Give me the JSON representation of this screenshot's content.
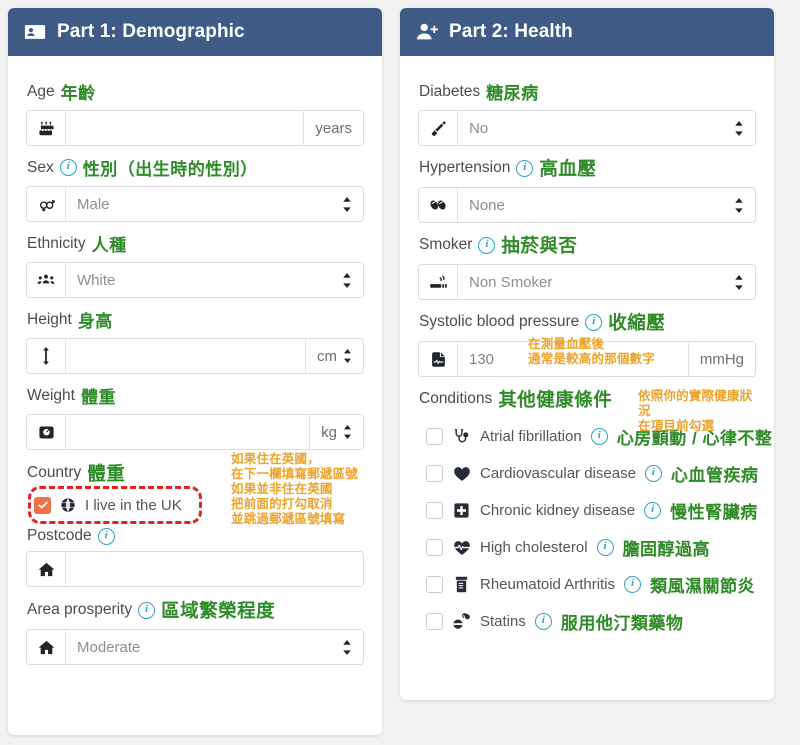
{
  "colors": {
    "header_bg": "#3f5c87",
    "translation_green": "#2e8b28",
    "annotation_orange": "#eda22a",
    "highlight_red": "#e0231f",
    "checkbox_orange": "#ef7147",
    "info_blue": "#29a3c4"
  },
  "part1": {
    "title": "Part 1: Demographic",
    "header_icon": "id-card-icon",
    "fields": {
      "age": {
        "label": "Age",
        "zh": "年齡",
        "icon": "birthday-cake-icon",
        "value": "",
        "unit": "years"
      },
      "sex": {
        "label": "Sex",
        "zh": "性別（出生時的性別）",
        "icon": "gender-icon",
        "value": "Male"
      },
      "ethnicity": {
        "label": "Ethnicity",
        "zh": "人種",
        "icon": "people-group-icon",
        "value": "White"
      },
      "height": {
        "label": "Height",
        "zh": "身高",
        "icon": "arrows-up-down-icon",
        "value": "",
        "unit": "cm"
      },
      "weight": {
        "label": "Weight",
        "zh": "體重",
        "icon": "weight-scale-icon",
        "value": "",
        "unit": "kg"
      },
      "country": {
        "label": "Country",
        "zh": "體重",
        "checkbox_icon": "globe-icon",
        "checkbox_label": "I live in the UK",
        "checked": true,
        "note": "如果住在英國，\n在下一欄填寫郵遞區號\n如果並非住在英國\n把前面的打勾取消\n並跳過郵遞區號填寫"
      },
      "postcode": {
        "label": "Postcode",
        "icon": "home-icon",
        "value": ""
      },
      "area_prosperity": {
        "label": "Area prosperity",
        "zh": "區域繁榮程度",
        "icon": "home-icon",
        "value": "Moderate"
      }
    }
  },
  "part2": {
    "title": "Part 2: Health",
    "header_icon": "user-plus-icon",
    "fields": {
      "diabetes": {
        "label": "Diabetes",
        "zh": "糖尿病",
        "icon": "syringe-icon",
        "value": "No"
      },
      "hypertension": {
        "label": "Hypertension",
        "zh": "高血壓",
        "icon": "pills-icon",
        "value": "None"
      },
      "smoker": {
        "label": "Smoker",
        "zh": "抽菸與否",
        "icon": "cigarette-icon",
        "value": "Non Smoker"
      },
      "systolic": {
        "label": "Systolic blood pressure",
        "zh": "收縮壓",
        "icon": "file-waveform-icon",
        "value": "130",
        "unit": "mmHg",
        "note": "在測量血壓後\n通常是較高的那個數字"
      },
      "conditions": {
        "label": "Conditions",
        "zh": "其他健康條件",
        "note": "依照你的實際健康狀況\n在項目前勾選",
        "items": [
          {
            "icon": "stethoscope-icon",
            "name": "Atrial fibrillation",
            "zh": "心房顫動 / 心律不整",
            "checked": false
          },
          {
            "icon": "heart-icon",
            "name": "Cardiovascular disease",
            "zh": "心血管疾病",
            "checked": false
          },
          {
            "icon": "hospital-plus-icon",
            "name": "Chronic kidney disease",
            "zh": "慢性腎臟病",
            "checked": false
          },
          {
            "icon": "heart-pulse-icon",
            "name": "High cholesterol",
            "zh": "膽固醇過高",
            "checked": false
          },
          {
            "icon": "prescription-bottle-icon",
            "name": "Rheumatoid Arthritis",
            "zh": "類風濕關節炎",
            "checked": false
          },
          {
            "icon": "capsules-icon",
            "name": "Statins",
            "zh": "服用他汀類藥物",
            "checked": false
          }
        ]
      }
    }
  }
}
